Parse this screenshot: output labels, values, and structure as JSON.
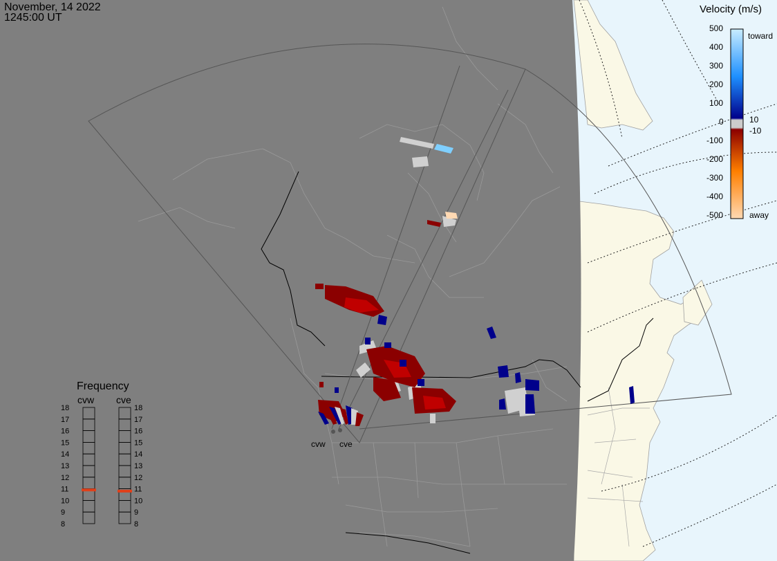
{
  "header": {
    "date": "November, 14 2022",
    "time": "1245:00 UT"
  },
  "velocity_scale": {
    "title": "Velocity (m/s)",
    "ticks": [
      "500",
      "400",
      "300",
      "200",
      "100",
      "0",
      "-100",
      "-200",
      "-300",
      "-400",
      "-500"
    ],
    "small_ticks": [
      "10",
      "-10"
    ],
    "end_labels": [
      "toward",
      "away"
    ],
    "colors": {
      "toward_light": "#c8ecff",
      "toward_mid": "#1e90ff",
      "toward_dark": "#00008b",
      "zero_band": "#cccccc",
      "away_dark": "#8b0000",
      "away_mid": "#ff7f00",
      "away_light": "#ffd9b3"
    }
  },
  "frequency": {
    "title": "Frequency",
    "radars": [
      "cvw",
      "cve"
    ],
    "ticks": [
      "18",
      "17",
      "16",
      "15",
      "14",
      "13",
      "12",
      "11",
      "10",
      "9",
      "8"
    ],
    "range_mhz": [
      8,
      18
    ],
    "values_mhz": [
      10.9,
      10.8
    ],
    "marker_color": "#e0401a"
  },
  "map": {
    "colors": {
      "night": "#7f7f7f",
      "land_day": "#faf8e6",
      "ocean_day": "#e8f5fc",
      "border_night": "#9a9a9a",
      "fov": "#555555",
      "political_border": "#000000",
      "no_flow": "#d0d0d0"
    },
    "sites": [
      "cvw",
      "cve"
    ]
  }
}
